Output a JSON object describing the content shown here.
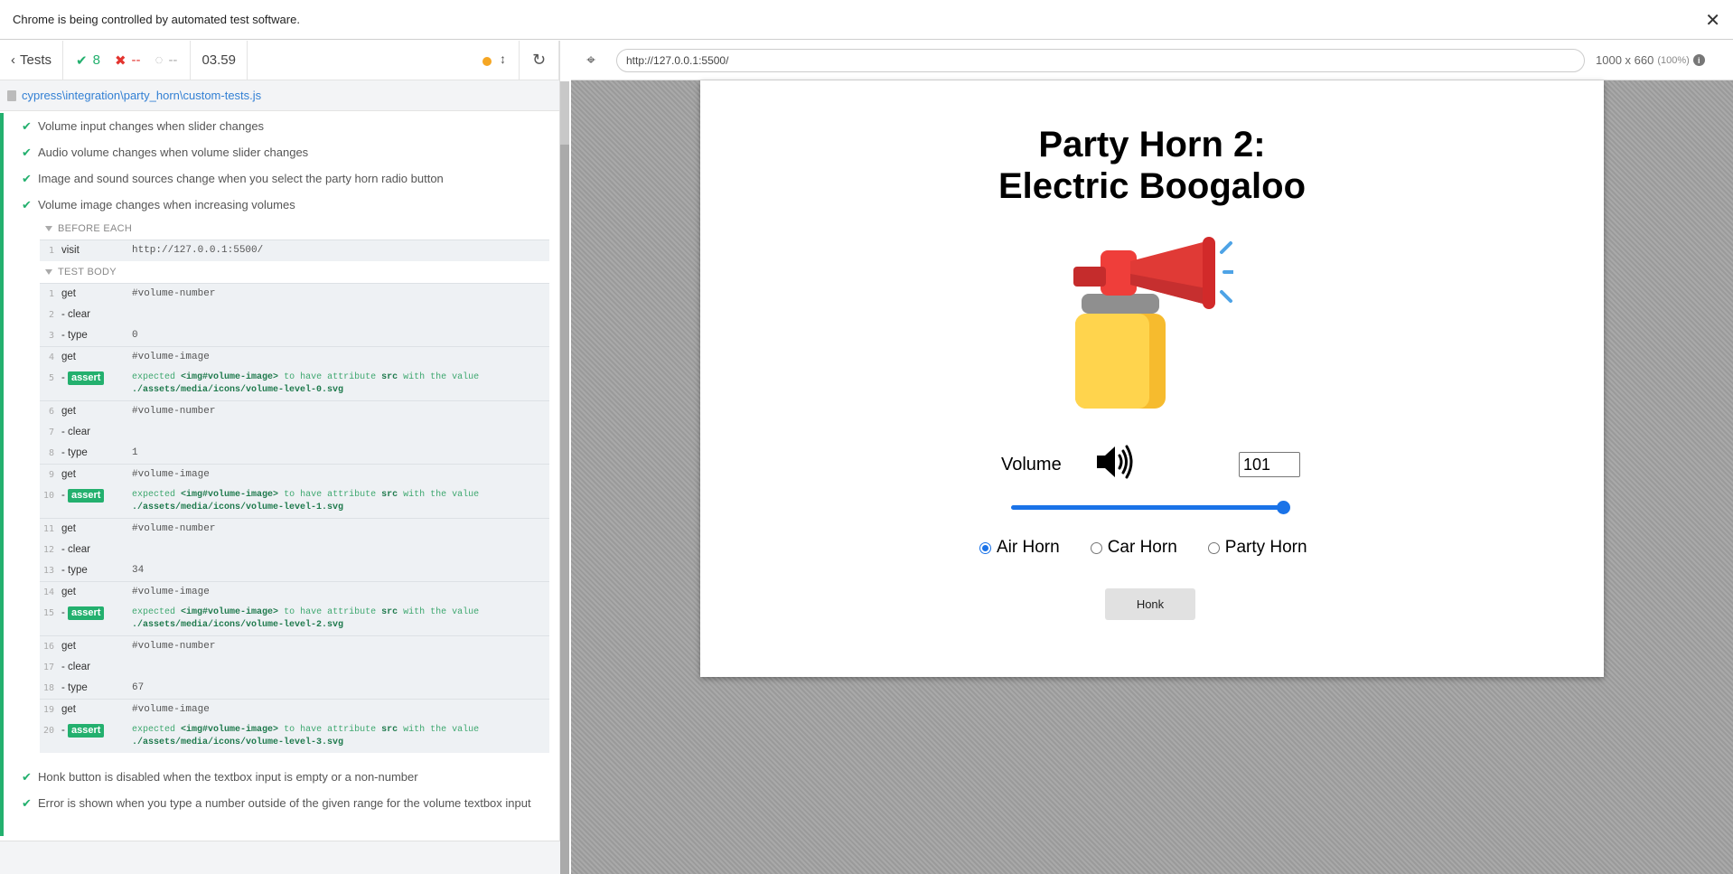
{
  "banner": {
    "text": "Chrome is being controlled by automated test software.",
    "close": "✕"
  },
  "reporter": {
    "tests_label": "Tests",
    "passed": "8",
    "failed": "--",
    "pending": "--",
    "duration": "03.59",
    "spec_file": "cypress\\integration\\party_horn\\custom-tests.js",
    "tests_before": [
      "Volume input changes when slider changes",
      "Audio volume changes when volume slider changes",
      "Image and sound sources change when you select the party horn radio button",
      "Volume image changes when increasing volumes"
    ],
    "before_each_label": "BEFORE EACH",
    "before_each": [
      {
        "num": "1",
        "name": "visit",
        "msg": "http://127.0.0.1:5500/"
      }
    ],
    "test_body_label": "TEST BODY",
    "body": [
      {
        "num": "1",
        "name": "get",
        "msg": "#volume-number"
      },
      {
        "num": "2",
        "name": "-clear",
        "msg": ""
      },
      {
        "num": "3",
        "name": "-type",
        "msg": "0"
      },
      {
        "num": "4",
        "name": "get",
        "msg": "#volume-image"
      },
      {
        "num": "5",
        "name": "-assert",
        "assert": true,
        "expected": "expected",
        "subject": "<img#volume-image>",
        "mid": "to have attribute",
        "attr": "src",
        "with": "with the value",
        "value": "./assets/media/icons/volume-level-0.svg"
      },
      {
        "num": "6",
        "name": "get",
        "msg": "#volume-number"
      },
      {
        "num": "7",
        "name": "-clear",
        "msg": ""
      },
      {
        "num": "8",
        "name": "-type",
        "msg": "1"
      },
      {
        "num": "9",
        "name": "get",
        "msg": "#volume-image"
      },
      {
        "num": "10",
        "name": "-assert",
        "assert": true,
        "expected": "expected",
        "subject": "<img#volume-image>",
        "mid": "to have attribute",
        "attr": "src",
        "with": "with the value",
        "value": "./assets/media/icons/volume-level-1.svg"
      },
      {
        "num": "11",
        "name": "get",
        "msg": "#volume-number"
      },
      {
        "num": "12",
        "name": "-clear",
        "msg": ""
      },
      {
        "num": "13",
        "name": "-type",
        "msg": "34"
      },
      {
        "num": "14",
        "name": "get",
        "msg": "#volume-image"
      },
      {
        "num": "15",
        "name": "-assert",
        "assert": true,
        "expected": "expected",
        "subject": "<img#volume-image>",
        "mid": "to have attribute",
        "attr": "src",
        "with": "with the value",
        "value": "./assets/media/icons/volume-level-2.svg"
      },
      {
        "num": "16",
        "name": "get",
        "msg": "#volume-number"
      },
      {
        "num": "17",
        "name": "-clear",
        "msg": ""
      },
      {
        "num": "18",
        "name": "-type",
        "msg": "67"
      },
      {
        "num": "19",
        "name": "get",
        "msg": "#volume-image"
      },
      {
        "num": "20",
        "name": "-assert",
        "assert": true,
        "expected": "expected",
        "subject": "<img#volume-image>",
        "mid": "to have attribute",
        "attr": "src",
        "with": "with the value",
        "value": "./assets/media/icons/volume-level-3.svg"
      }
    ],
    "tests_after": [
      "Honk button is disabled when the textbox input is empty or a non-number",
      "Error is shown when you type a number outside of the given range for the volume textbox input"
    ]
  },
  "aut": {
    "url": "http://127.0.0.1:5500/",
    "viewport": "1000 x 660",
    "zoom": "(100%)"
  },
  "app": {
    "title_line1": "Party Horn 2:",
    "title_line2": "Electric Boogaloo",
    "volume_label": "Volume",
    "volume_value": "101",
    "slider_value": 100,
    "radios": [
      {
        "label": "Air Horn",
        "checked": true
      },
      {
        "label": "Car Horn",
        "checked": false
      },
      {
        "label": "Party Horn",
        "checked": false
      }
    ],
    "honk_label": "Honk"
  }
}
